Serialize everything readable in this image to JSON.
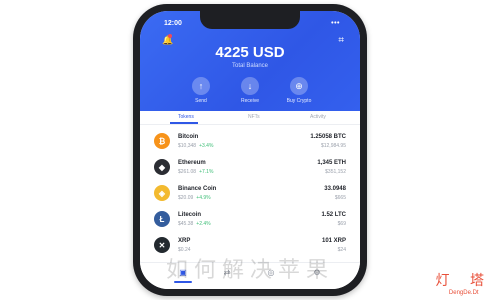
{
  "status": {
    "time": "12:00",
    "right": "•••"
  },
  "wallet": {
    "balance": "4225 USD",
    "balance_sub": "Total Balance",
    "actions": [
      {
        "label": "Send",
        "icon": "arrow-up-icon",
        "glyph": "↑"
      },
      {
        "label": "Receive",
        "icon": "arrow-down-icon",
        "glyph": "↓"
      },
      {
        "label": "Buy Crypto",
        "icon": "tag-icon",
        "glyph": "⊕"
      }
    ]
  },
  "tabs": {
    "tokens": "Tokens",
    "nft": "NFTs",
    "activity": "Activity"
  },
  "assets": [
    {
      "name": "Bitcoin",
      "price": "$10,348",
      "change": "+3.4%",
      "amount": "1.25058 BTC",
      "value": "$12,984.95",
      "color": "#f7931a",
      "glyph": "₿"
    },
    {
      "name": "Ethereum",
      "price": "$261.08",
      "change": "+7.1%",
      "amount": "1,345 ETH",
      "value": "$351,152",
      "color": "#2b2d33",
      "glyph": "◆"
    },
    {
      "name": "Binance Coin",
      "price": "$20.09",
      "change": "+4.9%",
      "amount": "33.0948",
      "value": "$665",
      "color": "#f3ba2f",
      "glyph": "◈"
    },
    {
      "name": "Litecoin",
      "price": "$45.38",
      "change": "+2.4%",
      "amount": "1.52 LTC",
      "value": "$69",
      "color": "#345d9d",
      "glyph": "Ł"
    },
    {
      "name": "XRP",
      "price": "$0.24",
      "change": "",
      "amount": "101 XRP",
      "value": "$24",
      "color": "#23292f",
      "glyph": "✕"
    }
  ],
  "nav": {
    "wallet": "wallet-icon",
    "swap": "swap-icon",
    "browser": "browser-icon",
    "settings": "settings-icon"
  },
  "watermark": "如何解决苹果",
  "logo": {
    "cn": "灯 塔",
    "en": "DengDe.Dt"
  }
}
